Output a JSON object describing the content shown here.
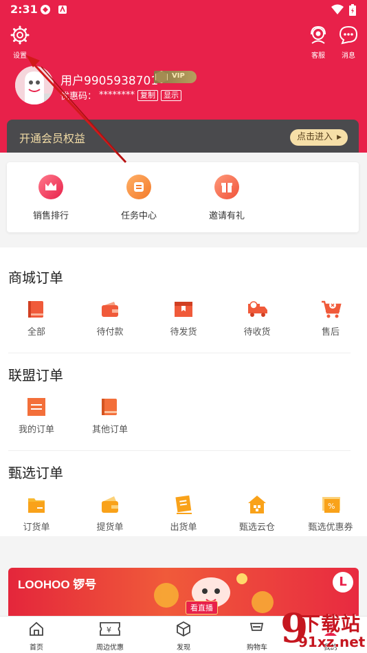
{
  "status_bar": {
    "time": "2:31"
  },
  "header": {
    "settings_label": "设置",
    "service_label": "客服",
    "messages_label": "消息",
    "username": "用户9905938701",
    "vip_label": "VIP",
    "promo_code_label": "优惠码：",
    "promo_code_value": "********",
    "copy_label": "复制",
    "show_label": "显示",
    "member_bar_title": "开通会员权益",
    "member_bar_button": "点击进入"
  },
  "quick_actions": [
    {
      "label": "销售排行",
      "icon": "crown-icon"
    },
    {
      "label": "任务中心",
      "icon": "task-icon"
    },
    {
      "label": "邀请有礼",
      "icon": "gift-icon"
    }
  ],
  "mall_orders": {
    "title": "商城订单",
    "items": [
      {
        "label": "全部",
        "icon": "book-icon"
      },
      {
        "label": "待付款",
        "icon": "wallet-icon"
      },
      {
        "label": "待发货",
        "icon": "box-icon"
      },
      {
        "label": "待收货",
        "icon": "truck-icon"
      },
      {
        "label": "售后",
        "icon": "cart-return-icon"
      }
    ]
  },
  "alliance_orders": {
    "title": "联盟订单",
    "items": [
      {
        "label": "我的订单",
        "icon": "order-list-icon"
      },
      {
        "label": "其他订单",
        "icon": "book-icon"
      }
    ]
  },
  "select_orders": {
    "title": "甄选订单",
    "items": [
      {
        "label": "订货单",
        "icon": "folder-icon"
      },
      {
        "label": "提货单",
        "icon": "wallet-icon"
      },
      {
        "label": "出货单",
        "icon": "receipt-icon"
      },
      {
        "label": "甄选云仓",
        "icon": "warehouse-icon"
      },
      {
        "label": "甄选优惠券",
        "icon": "coupon-icon"
      }
    ]
  },
  "banner": {
    "logo_text": "LOOHOO 锣号",
    "live_label": "看直播",
    "badge": "L"
  },
  "tabbar": [
    {
      "label": "首页",
      "icon": "home-icon"
    },
    {
      "label": "周边优惠",
      "icon": "ticket-icon"
    },
    {
      "label": "发现",
      "icon": "cube-icon"
    },
    {
      "label": "购物车",
      "icon": "cart-icon"
    },
    {
      "label": "我的",
      "icon": "person-icon"
    }
  ],
  "watermark": {
    "digit": "9",
    "big_text": "下载站",
    "small_text": "91xz.net"
  },
  "colors": {
    "brand_red": "#e8214a",
    "gold": "#f6dfa8",
    "orange": "#f36f3a"
  }
}
